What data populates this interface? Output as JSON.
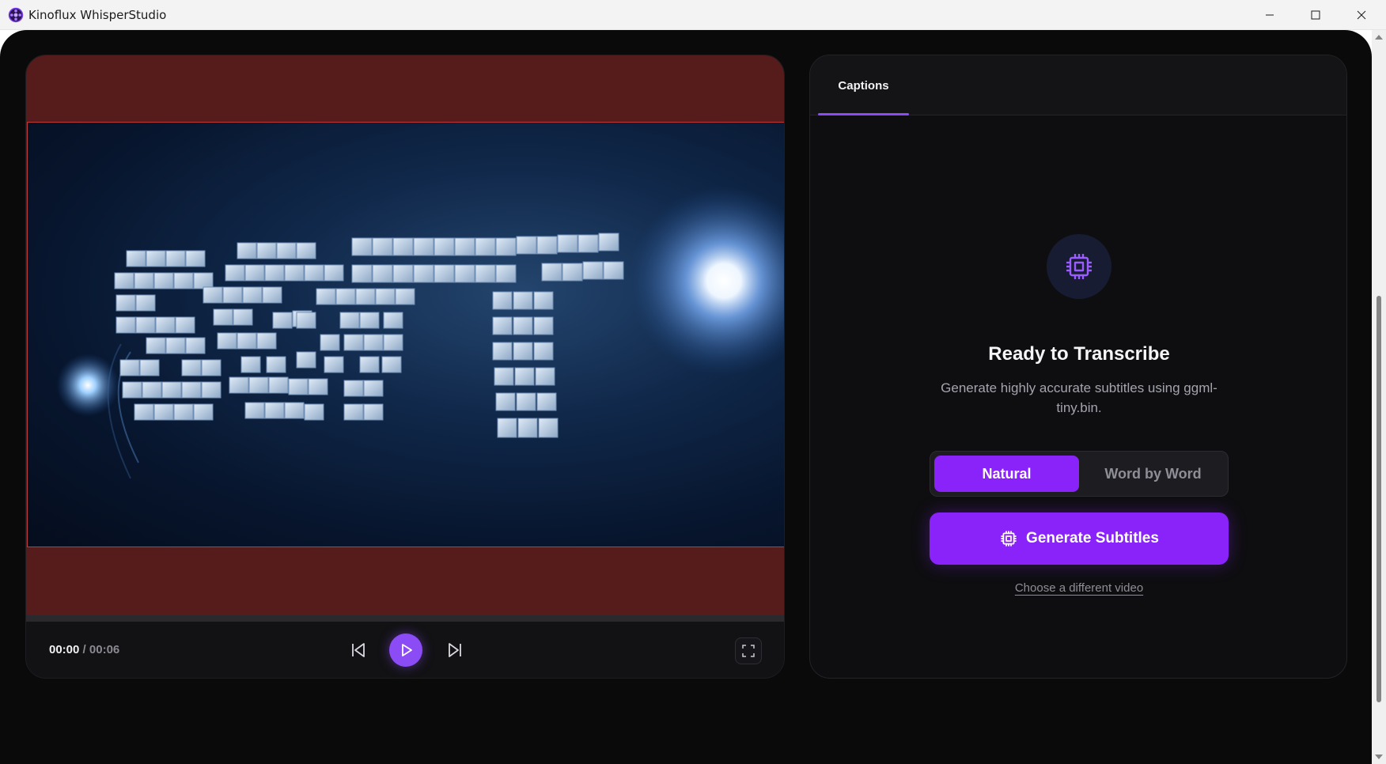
{
  "window": {
    "title": "Kinoflux WhisperStudio",
    "controls": [
      "minimize-icon",
      "maximize-icon",
      "close-icon"
    ]
  },
  "player": {
    "current_time": "00:00",
    "separator": "/",
    "duration": "00:06",
    "progress": 0,
    "buttons": [
      "skip-back-icon",
      "play-icon",
      "skip-forward-icon",
      "fullscreen-icon"
    ]
  },
  "captions": {
    "tab_label": "Captions",
    "icon": "cpu-chip-icon",
    "heading": "Ready to Transcribe",
    "description": "Generate highly accurate subtitles using ggml-tiny.bin.",
    "modes": [
      "Natural",
      "Word by Word"
    ],
    "selected_mode": "Natural",
    "generate_label": "Generate Subtitles",
    "choose_link": "Choose a different video"
  },
  "colors": {
    "accent": "#8a22fa",
    "video_letterbox": "#561b1b",
    "background": "#0b0a0b"
  }
}
